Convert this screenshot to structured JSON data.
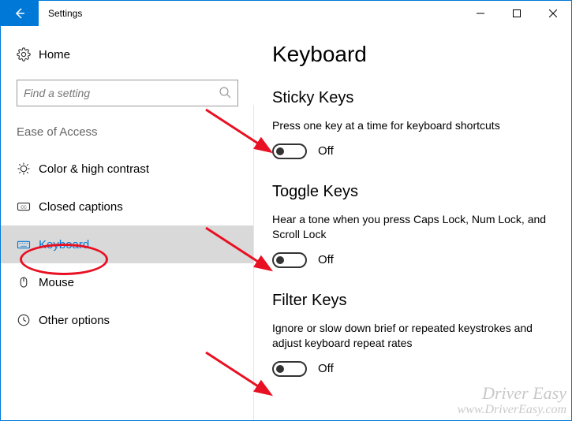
{
  "window": {
    "title": "Settings"
  },
  "sidebar": {
    "home": "Home",
    "search_placeholder": "Find a setting",
    "group": "Ease of Access",
    "items": [
      {
        "label": "Color & high contrast"
      },
      {
        "label": "Closed captions"
      },
      {
        "label": "Keyboard"
      },
      {
        "label": "Mouse"
      },
      {
        "label": "Other options"
      }
    ]
  },
  "page": {
    "title": "Keyboard",
    "sections": [
      {
        "title": "Sticky Keys",
        "desc": "Press one key at a time for keyboard shortcuts",
        "toggle_state": "Off"
      },
      {
        "title": "Toggle Keys",
        "desc": "Hear a tone when you press Caps Lock, Num Lock, and Scroll Lock",
        "toggle_state": "Off"
      },
      {
        "title": "Filter Keys",
        "desc": "Ignore or slow down brief or repeated keystrokes and adjust keyboard repeat rates",
        "toggle_state": "Off"
      }
    ]
  },
  "watermark": {
    "line1": "Driver Easy",
    "line2": "www.DriverEasy.com"
  },
  "annotation": {
    "circle_target": "Keyboard"
  }
}
